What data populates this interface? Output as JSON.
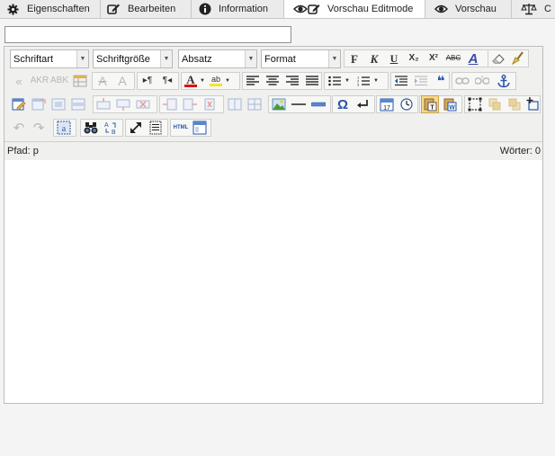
{
  "tabs": [
    {
      "label": "Eigenschaften",
      "icon": "gear-icon"
    },
    {
      "label": "Bearbeiten",
      "icon": "edit-icon"
    },
    {
      "label": "Information",
      "icon": "info-icon"
    },
    {
      "label": "Vorschau Editmode",
      "icon": "eye-edit-icon",
      "active": true
    },
    {
      "label": "Vorschau",
      "icon": "eye-icon"
    },
    {
      "label": "C",
      "icon": "scale-icon"
    }
  ],
  "title_input": {
    "value": "",
    "placeholder": ""
  },
  "editor": {
    "selects": {
      "font": "Schriftart",
      "size": "Schriftgröße",
      "paragraph": "Absatz",
      "format": "Format"
    },
    "buttons": {
      "bold": "F",
      "italic": "K",
      "underline": "U",
      "subscript": "X₂",
      "superscript": "X²",
      "strikethrough": "ABC",
      "styles": "A",
      "quote": "«",
      "omega": "Ω",
      "html": "HTML"
    },
    "abbreviations": [
      "AKR",
      "ABK"
    ],
    "status": {
      "path": "Pfad: p",
      "words": "Wörter: 0"
    }
  }
}
